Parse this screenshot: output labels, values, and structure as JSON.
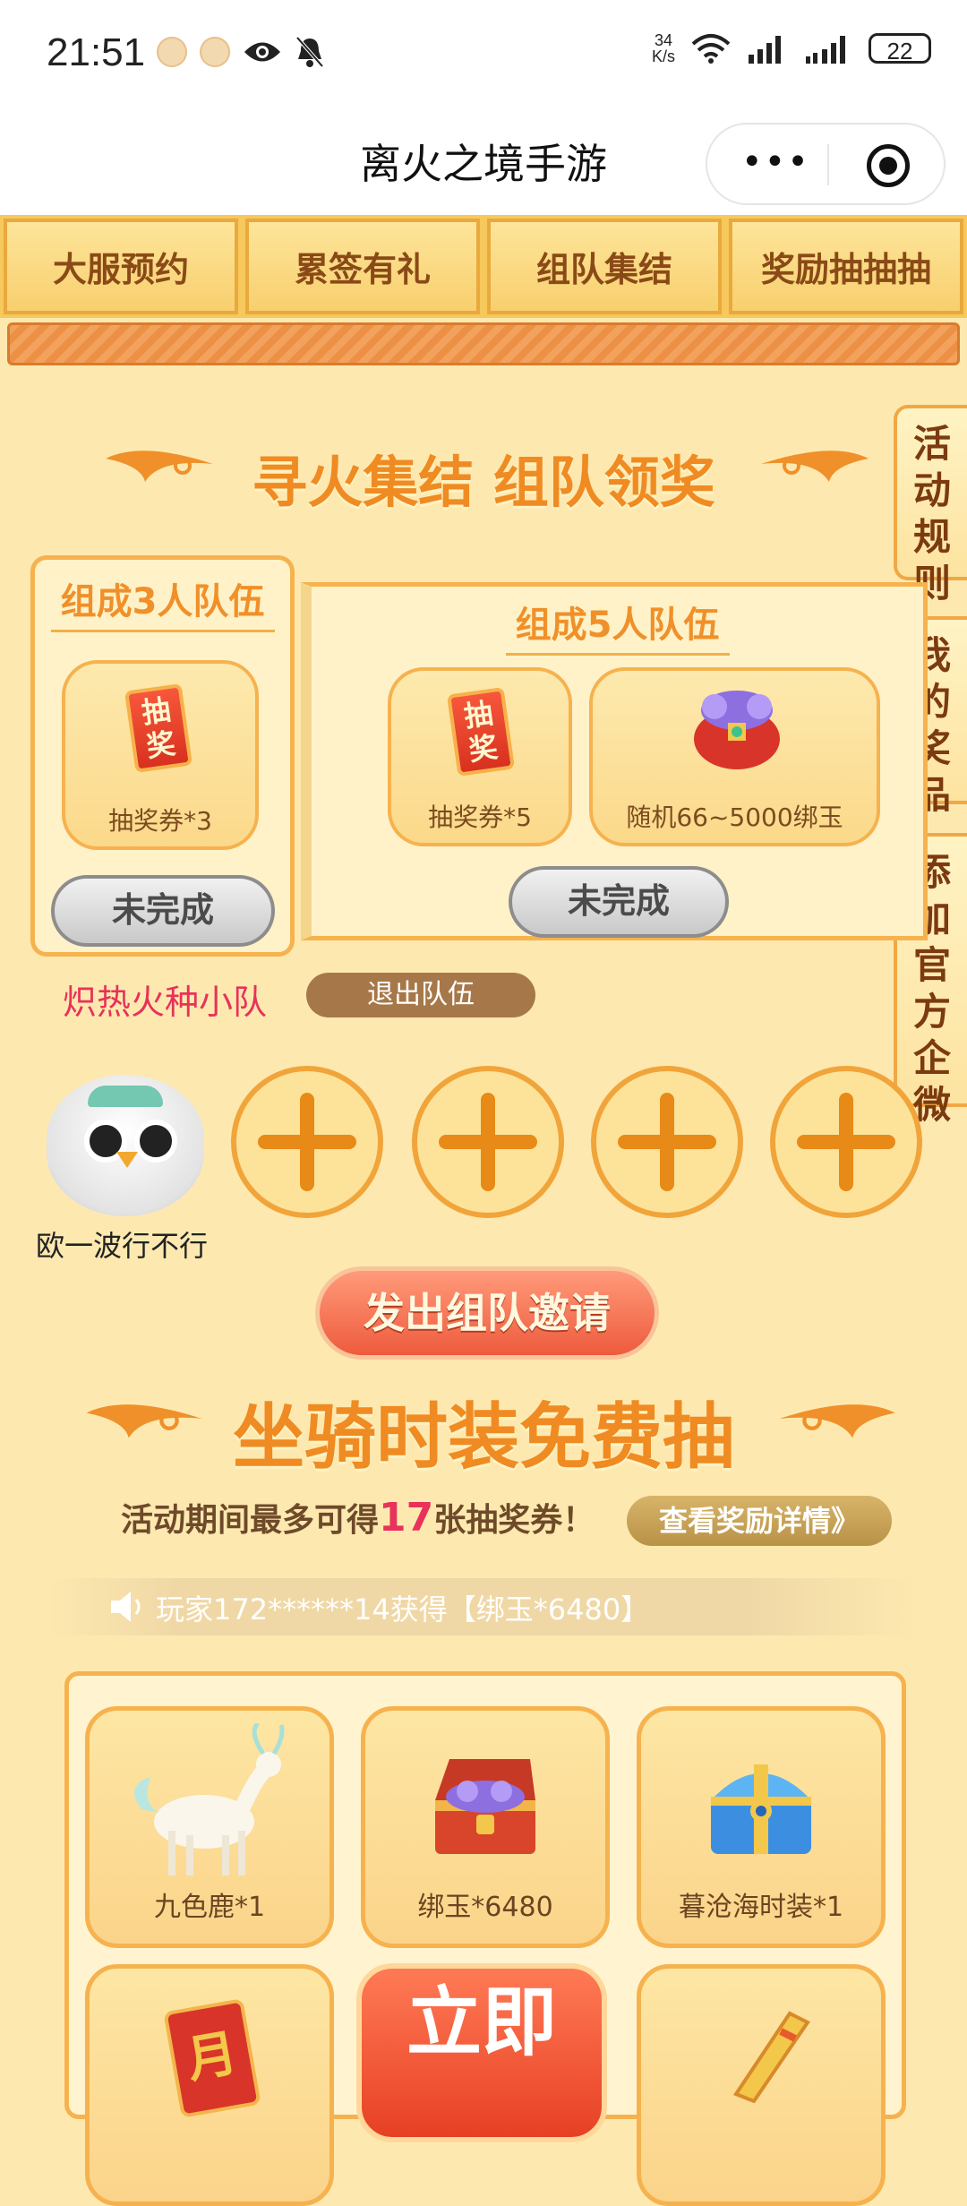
{
  "status_bar": {
    "time": "21:51",
    "speed": "34\nK/s",
    "battery": "22"
  },
  "nav": {
    "title": "离火之境手游",
    "more_glyph": "•••"
  },
  "tabs": [
    "大服预约",
    "累签有礼",
    "组队集结",
    "奖励抽抽抽"
  ],
  "section1": {
    "title": "寻火集结 组队领奖"
  },
  "side_buttons": [
    {
      "label": "活动规则"
    },
    {
      "label": "我的奖品"
    },
    {
      "label": "添加官方企微"
    }
  ],
  "team3": {
    "title": "组成3人队伍",
    "reward": {
      "ticket_text": "抽奖",
      "label": "抽奖券*3"
    },
    "status": "未完成"
  },
  "team5": {
    "title": "组成5人队伍",
    "rewards": [
      {
        "ticket_text": "抽奖",
        "label": "抽奖券*5"
      },
      {
        "label": "随机66~5000绑玉"
      }
    ],
    "status": "未完成"
  },
  "team": {
    "name": "炽热火种小队",
    "leave_label": "退出队伍",
    "player_name": "欧一波行不行"
  },
  "invite": {
    "label": "发出组队邀请"
  },
  "section2": {
    "title": "坐骑时装免费抽"
  },
  "promo": {
    "prefix": "活动期间最多可得",
    "number": "17",
    "suffix": "张抽奖券！",
    "detail_label": "查看奖励详情》"
  },
  "ticker": {
    "text": "玩家172******14获得【绑玉*6480】"
  },
  "prizes": [
    {
      "label": "九色鹿*1"
    },
    {
      "label": "绑玉*6480"
    },
    {
      "label": "暮沧海时装*1"
    }
  ],
  "draw": {
    "label": "立即",
    "card_char": "月"
  },
  "colors": {
    "accent": "#ef8b22",
    "team_name": "#e8325a",
    "invite": "#ee5b3d"
  }
}
